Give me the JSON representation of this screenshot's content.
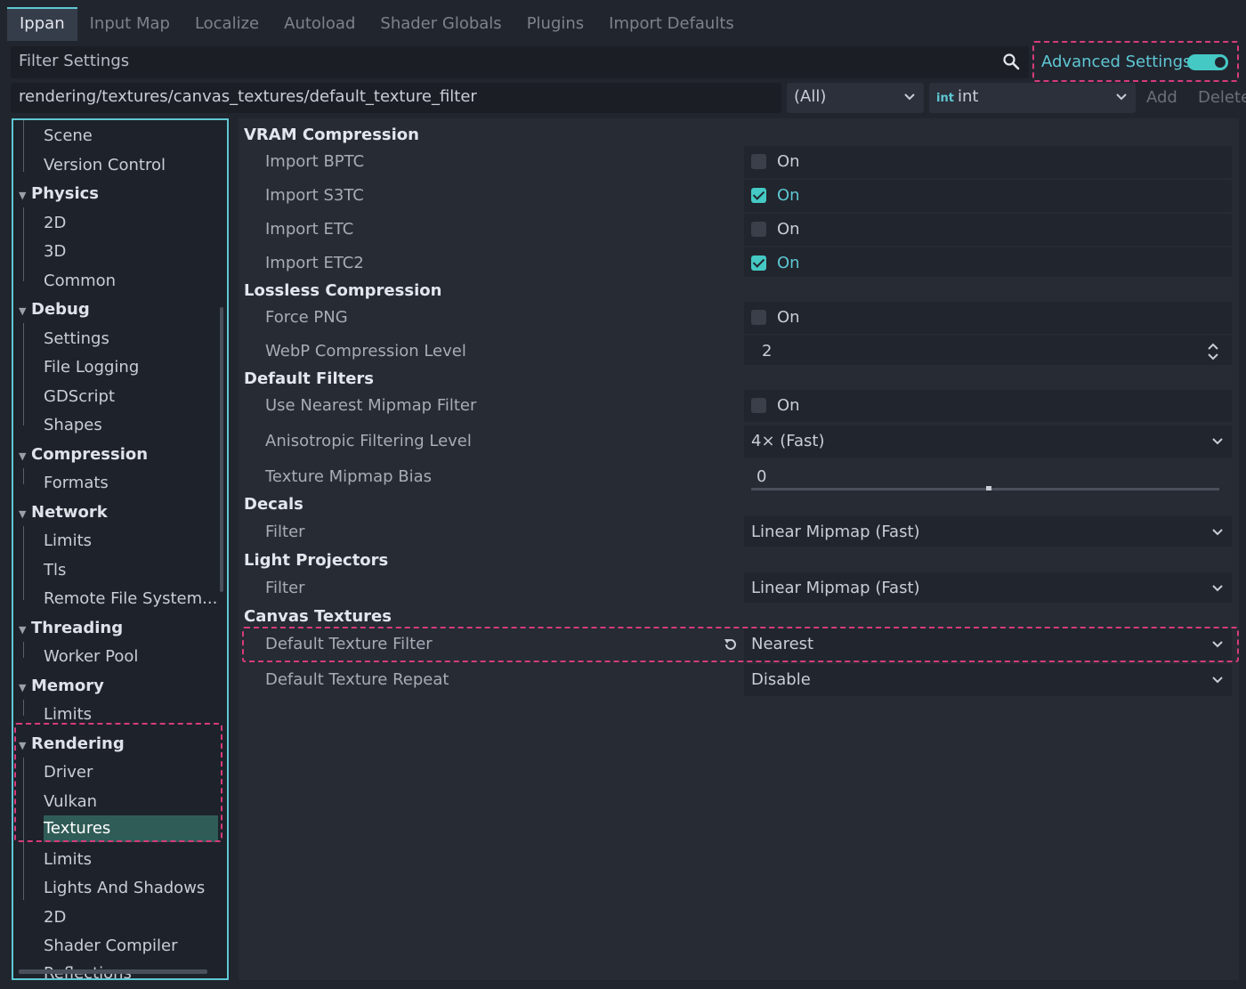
{
  "tabs": [
    "Ippan",
    "Input Map",
    "Localize",
    "Autoload",
    "Shader Globals",
    "Plugins",
    "Import Defaults"
  ],
  "filter": {
    "placeholder": "Filter Settings"
  },
  "advanced": {
    "label": "Advanced Settings",
    "enabled": true
  },
  "path_row": {
    "path": "rendering/textures/canvas_textures/default_texture_filter",
    "scope_select": "(All)",
    "type_icon": "int",
    "type_select": "int",
    "add_label": "Add",
    "delete_label": "Delete"
  },
  "tree": {
    "items": [
      {
        "label": "Scene",
        "level": 1
      },
      {
        "label": "Version Control",
        "level": 1
      },
      {
        "label": "Physics",
        "level": 0
      },
      {
        "label": "2D",
        "level": 1
      },
      {
        "label": "3D",
        "level": 1
      },
      {
        "label": "Common",
        "level": 1
      },
      {
        "label": "Debug",
        "level": 0
      },
      {
        "label": "Settings",
        "level": 1
      },
      {
        "label": "File Logging",
        "level": 1
      },
      {
        "label": "GDScript",
        "level": 1
      },
      {
        "label": "Shapes",
        "level": 1
      },
      {
        "label": "Compression",
        "level": 0
      },
      {
        "label": "Formats",
        "level": 1
      },
      {
        "label": "Network",
        "level": 0
      },
      {
        "label": "Limits",
        "level": 1
      },
      {
        "label": "Tls",
        "level": 1
      },
      {
        "label": "Remote File System...",
        "level": 1
      },
      {
        "label": "Threading",
        "level": 0
      },
      {
        "label": "Worker Pool",
        "level": 1
      },
      {
        "label": "Memory",
        "level": 0
      },
      {
        "label": "Limits",
        "level": 1
      },
      {
        "label": "Rendering",
        "level": 0
      },
      {
        "label": "Driver",
        "level": 1
      },
      {
        "label": "Vulkan",
        "level": 1
      },
      {
        "label": "Textures",
        "level": 1
      },
      {
        "label": "Limits",
        "level": 1
      },
      {
        "label": "Lights And Shadows",
        "level": 1
      },
      {
        "label": "2D",
        "level": 1
      },
      {
        "label": "Shader Compiler",
        "level": 1
      },
      {
        "label": "Reflections",
        "level": 1
      }
    ]
  },
  "inspector": {
    "sections": [
      {
        "title": "VRAM Compression",
        "props": [
          {
            "label": "Import BPTC",
            "type": "check",
            "checked": false,
            "value": "On"
          },
          {
            "label": "Import S3TC",
            "type": "check",
            "checked": true,
            "value": "On"
          },
          {
            "label": "Import ETC",
            "type": "check",
            "checked": false,
            "value": "On"
          },
          {
            "label": "Import ETC2",
            "type": "check",
            "checked": true,
            "value": "On"
          }
        ]
      },
      {
        "title": "Lossless Compression",
        "props": [
          {
            "label": "Force PNG",
            "type": "check",
            "checked": false,
            "value": "On"
          },
          {
            "label": "WebP Compression Level",
            "type": "spin",
            "value": "2"
          }
        ]
      },
      {
        "title": "Default Filters",
        "props": [
          {
            "label": "Use Nearest Mipmap Filter",
            "type": "check",
            "checked": false,
            "value": "On"
          },
          {
            "label": "Anisotropic Filtering Level",
            "type": "select",
            "value": "4× (Fast)"
          },
          {
            "label": "Texture Mipmap Bias",
            "type": "slider",
            "value": "0",
            "level": 0.5
          }
        ]
      },
      {
        "title": "Decals",
        "props": [
          {
            "label": "Filter",
            "type": "select",
            "value": "Linear Mipmap (Fast)"
          }
        ]
      },
      {
        "title": "Light Projectors",
        "props": [
          {
            "label": "Filter",
            "type": "select",
            "value": "Linear Mipmap (Fast)"
          }
        ]
      },
      {
        "title": "Canvas Textures",
        "props": [
          {
            "label": "Default Texture Filter",
            "type": "select",
            "value": "Nearest",
            "revert": true
          },
          {
            "label": "Default Texture Repeat",
            "type": "select",
            "value": "Disable"
          }
        ]
      }
    ]
  },
  "colors": {
    "accent": "#5ec8d4",
    "highlight": "#d63b7e",
    "selected_row": "#305c57"
  }
}
